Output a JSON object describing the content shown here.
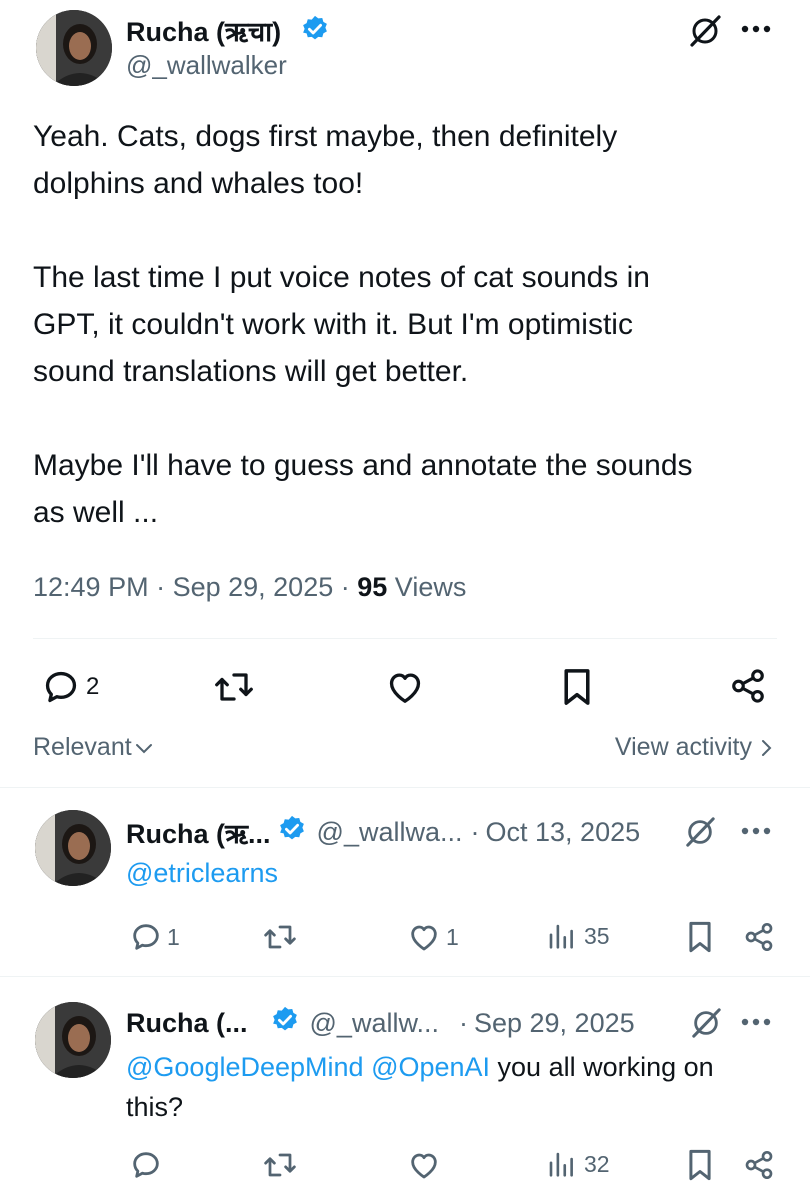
{
  "main_post": {
    "author_name": "Rucha (ऋचा)",
    "author_handle": "@_wallwalker",
    "body": "Yeah. Cats, dogs first maybe, then definitely\ndolphins and whales too!\n\nThe last time I put voice notes of cat sounds in\nGPT, it couldn't work with it. But I'm optimistic\nsound translations will get better.\n\nMaybe I'll have to guess and annotate the sounds\nas well ...",
    "time": "12:49 PM",
    "date": "Sep 29, 2025",
    "views_count": "95",
    "views_label": "Views",
    "reply_count": "2"
  },
  "sort": {
    "label": "Relevant",
    "view_activity": "View activity"
  },
  "replies": [
    {
      "author_name": "Rucha (ऋ...",
      "author_handle": "@_wallwa...",
      "separator": "·",
      "date": "Oct 13, 2025",
      "mention": "@etriclearns",
      "reply_count": "1",
      "like_count": "1",
      "views": "35"
    },
    {
      "author_name": "Rucha (...",
      "author_handle": "@_wallw...",
      "separator": "·",
      "date": "Sep 29, 2025",
      "mention_1": "@GoogleDeepMind",
      "mention_2": "@OpenAI",
      "text_1": " you all working on",
      "text_2": "this?",
      "views": "32"
    }
  ],
  "icons": [
    "verified-badge-icon",
    "grok-icon",
    "more-icon",
    "reply-icon",
    "repost-icon",
    "like-icon",
    "views-icon",
    "bookmark-icon",
    "share-icon",
    "chevron-down-icon",
    "chevron-right-icon"
  ],
  "colors": {
    "accent": "#1d9bf0",
    "text": "#0f1419",
    "muted": "#536471",
    "divider": "#eff3f4"
  }
}
